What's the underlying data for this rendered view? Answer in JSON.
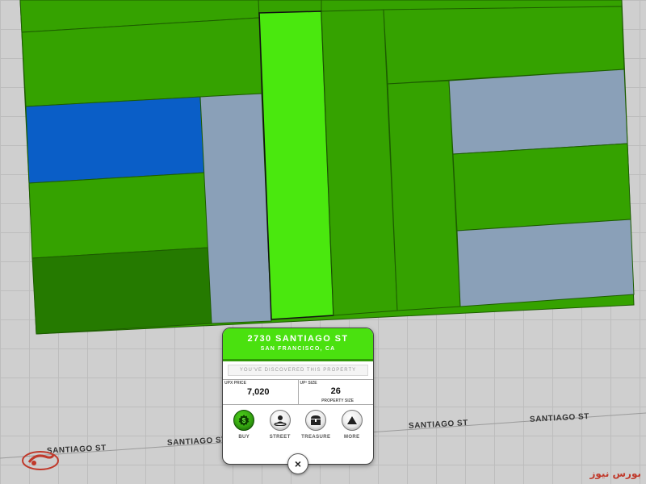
{
  "map": {
    "streets": [
      {
        "id": "santiago-left",
        "label": "SANTIAGO ST"
      },
      {
        "id": "santiago-mid",
        "label": "SANTIAGO ST"
      },
      {
        "id": "santiago-right",
        "label": "SANTIAGO ST"
      },
      {
        "id": "santiago-far",
        "label": "SANTIAGO ST"
      }
    ],
    "colors": {
      "owned_green": "#35a200",
      "dark_green": "#257a00",
      "selected": "#4ae80e",
      "blue": "#0a5ec7",
      "grey_blue": "#8aa0b8",
      "grid_bg": "#cfcfcf"
    }
  },
  "card": {
    "address": "2730 SANTIAGO ST",
    "city": "SAN FRANCISCO, CA",
    "discovered": "YOU'VE DISCOVERED THIS PROPERTY",
    "price_label": "UPX PRICE",
    "price_value": "7,020",
    "size_label": "UP² SIZE",
    "size_value": "26",
    "size_caption": "PROPERTY SIZE",
    "actions": [
      {
        "label": "BUY",
        "icon": "dollar-icon"
      },
      {
        "label": "STREET",
        "icon": "street-person-icon"
      },
      {
        "label": "TREASURE",
        "icon": "treasure-chest-icon"
      },
      {
        "label": "MORE",
        "icon": "triangle-up-icon"
      }
    ],
    "close_glyph": "×",
    "header_color": "#4ae10f"
  },
  "watermark": {
    "text": "بورس نیوز"
  }
}
